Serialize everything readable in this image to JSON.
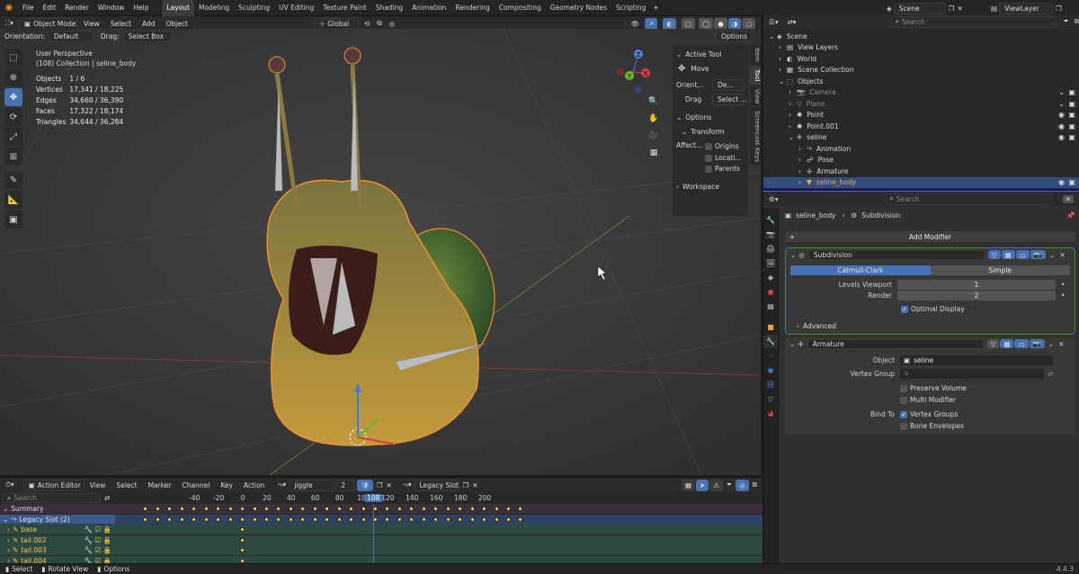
{
  "topbar": {
    "menus": [
      "File",
      "Edit",
      "Render",
      "Window",
      "Help"
    ],
    "workspaces": [
      "Layout",
      "Modeling",
      "Sculpting",
      "UV Editing",
      "Texture Paint",
      "Shading",
      "Animation",
      "Rendering",
      "Compositing",
      "Geometry Nodes",
      "Scripting"
    ],
    "active_workspace": "Layout",
    "scene": "Scene",
    "view_layer": "ViewLayer"
  },
  "viewport_header": {
    "mode": "Object Mode",
    "menus": [
      "View",
      "Select",
      "Add",
      "Object"
    ],
    "orientation_transform": "Global",
    "orientation_label": "Orientation:",
    "orientation_value": "Default",
    "drag_label": "Drag:",
    "drag_value": "Select Box",
    "options": "Options"
  },
  "viewport_overlay": {
    "perspective": "User Perspective",
    "collection": "(108) Collection | seline_body",
    "stats": [
      {
        "label": "Objects",
        "value": "1 / 6"
      },
      {
        "label": "Vertices",
        "value": "17,341 / 18,225"
      },
      {
        "label": "Edges",
        "value": "34,660 / 36,390"
      },
      {
        "label": "Faces",
        "value": "17,322 / 18,174"
      },
      {
        "label": "Triangles",
        "value": "34,644 / 36,284"
      }
    ]
  },
  "npanel": {
    "active_tool_title": "Active Tool",
    "tool_name": "Move",
    "orient_label": "Orient...",
    "orient_value": "De...",
    "drag_label": "Drag",
    "drag_value": "Select ...",
    "options_title": "Options",
    "transform_title": "Transform",
    "affect_label": "Affect...",
    "affect_items": [
      "Origins",
      "Locati...",
      "Parents"
    ],
    "workspace_title": "Workspace",
    "tabs": [
      "Item",
      "Tool",
      "View",
      "Screencast Keys"
    ]
  },
  "gizmo": {
    "z": "Z",
    "y": "Y",
    "x": "X"
  },
  "outliner": {
    "search_placeholder": "Search",
    "items": [
      {
        "label": "Scene",
        "indent": 0,
        "color": "#d8d8d8",
        "icon": "scene-icon"
      },
      {
        "label": "View Layers",
        "indent": 1,
        "color": "#d8d8d8",
        "icon": "view-layers-icon"
      },
      {
        "label": "World",
        "indent": 1,
        "color": "#d8d8d8",
        "icon": "world-icon"
      },
      {
        "label": "Scene Collection",
        "indent": 1,
        "color": "#d8d8d8",
        "icon": "collection-icon"
      },
      {
        "label": "Objects",
        "indent": 1,
        "color": "#d8d8d8",
        "icon": "objects-icon"
      },
      {
        "label": "Camera",
        "indent": 2,
        "color": "#8a8a8a",
        "icon": "camera-icon"
      },
      {
        "label": "Plane",
        "indent": 2,
        "color": "#8a8a8a",
        "icon": "mesh-icon"
      },
      {
        "label": "Point",
        "indent": 2,
        "color": "#d8d8d8",
        "icon": "light-icon"
      },
      {
        "label": "Point.001",
        "indent": 2,
        "color": "#d8d8d8",
        "icon": "light-icon"
      },
      {
        "label": "seline",
        "indent": 2,
        "color": "#d8d8d8",
        "icon": "armature-icon"
      },
      {
        "label": "Animation",
        "indent": 3,
        "color": "#d8d8d8",
        "icon": "animation-icon"
      },
      {
        "label": "Pose",
        "indent": 3,
        "color": "#d8d8d8",
        "icon": "pose-icon"
      },
      {
        "label": "Armature",
        "indent": 3,
        "color": "#d8d8d8",
        "icon": "armature-data-icon"
      },
      {
        "label": "seline_body",
        "indent": 3,
        "color": "#f0b040",
        "icon": "mesh-object-icon"
      }
    ]
  },
  "properties": {
    "search_placeholder": "Search",
    "breadcrumb_object": "seline_body",
    "breadcrumb_modifier": "Subdivision",
    "add_modifier": "Add Modifier",
    "subdivision": {
      "name": "Subdivision",
      "type_options": [
        "Catmull-Clark",
        "Simple"
      ],
      "levels_viewport_label": "Levels Viewport",
      "levels_viewport": "1",
      "render_label": "Render",
      "render": "2",
      "optimal_display": "Optimal Display",
      "advanced": "Advanced"
    },
    "armature": {
      "name": "Armature",
      "object_label": "Object",
      "object_value": "seline",
      "vertex_group_label": "Vertex Group",
      "preserve_volume": "Preserve Volume",
      "multi_modifier": "Multi Modifier",
      "bind_to_label": "Bind To",
      "vertex_groups": "Vertex Groups",
      "bone_envelopes": "Bone Envelopes"
    }
  },
  "action_editor": {
    "mode": "Action Editor",
    "menus": [
      "View",
      "Select",
      "Marker",
      "Channel",
      "Key",
      "Action"
    ],
    "action": "jiggle",
    "users": "2",
    "slot": "Legacy Slot",
    "search_placeholder": "Search",
    "frame_ticks": [
      "-40",
      "-20",
      "0",
      "20",
      "40",
      "60",
      "80",
      "100",
      "120",
      "140",
      "160",
      "180",
      "200"
    ],
    "current_frame": "108",
    "channels": [
      {
        "label": "Summary",
        "kind": "summary"
      },
      {
        "label": "Legacy Slot (2)",
        "kind": "slot"
      },
      {
        "label": "base",
        "kind": "bone"
      },
      {
        "label": "tail.002",
        "kind": "bone"
      },
      {
        "label": "tail.003",
        "kind": "bone"
      },
      {
        "label": "tail.004",
        "kind": "bone"
      }
    ]
  },
  "statusbar": {
    "items": [
      "Select",
      "Rotate View",
      "Options"
    ],
    "version": "4.4.3"
  },
  "colors": {
    "accent": "#4772b3",
    "selected_object": "#f0b040",
    "header": "#2b2b2b"
  }
}
